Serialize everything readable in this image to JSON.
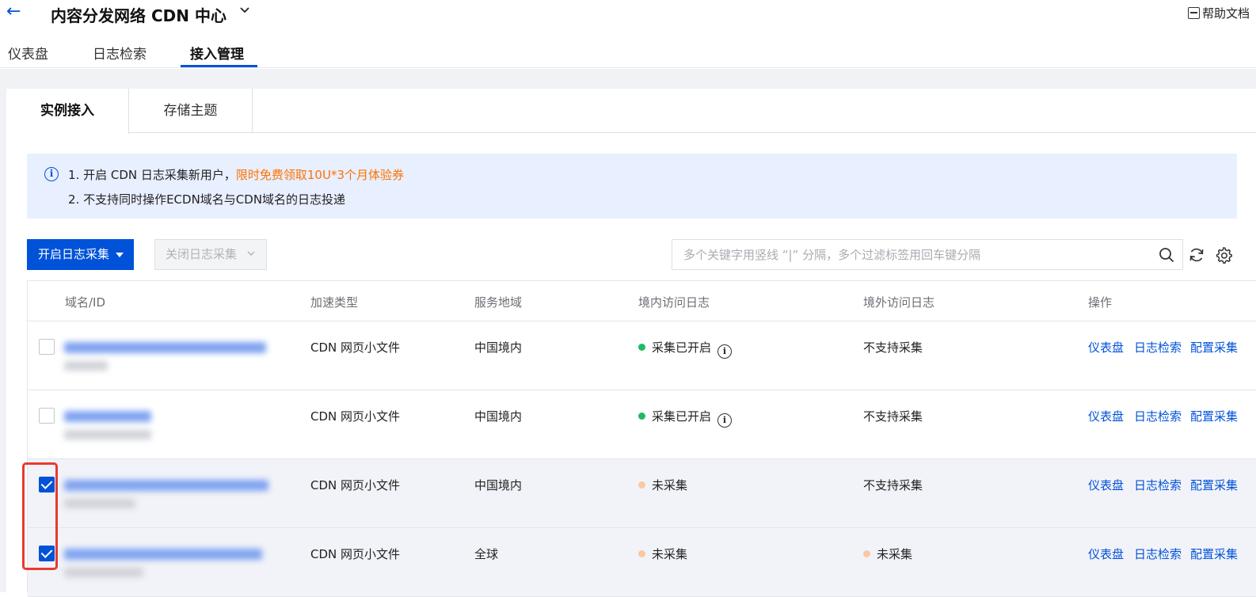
{
  "header": {
    "back_icon": "arrow-left-icon",
    "title": "内容分发网络 CDN 中心",
    "help": "帮助文档"
  },
  "nav_tabs": [
    {
      "label": "仪表盘",
      "active": false
    },
    {
      "label": "日志检索",
      "active": false
    },
    {
      "label": "接入管理",
      "active": true
    }
  ],
  "sub_tabs": [
    {
      "label": "实例接入",
      "active": true
    },
    {
      "label": "存储主题",
      "active": false
    }
  ],
  "notice": {
    "line1_prefix": "1. 开启 CDN 日志采集新用户，",
    "line1_link": "限时免费领取10U*3个月体验券",
    "line2": "2. 不支持同时操作ECDN域名与CDN域名的日志投递"
  },
  "toolbar": {
    "enable_button": "开启日志采集",
    "disable_button": "关闭日志采集",
    "search_placeholder": "多个关键字用竖线 “|” 分隔，多个过滤标签用回车键分隔"
  },
  "table": {
    "columns": [
      "域名/ID",
      "加速类型",
      "服务地域",
      "境内访问日志",
      "境外访问日志",
      "操作"
    ],
    "rows": [
      {
        "checked": false,
        "type": "CDN 网页小文件",
        "region": "中国境内",
        "domestic": "采集已开启",
        "domestic_status": "on",
        "overseas": "不支持采集",
        "overseas_status": "none"
      },
      {
        "checked": false,
        "type": "CDN 网页小文件",
        "region": "中国境内",
        "domestic": "采集已开启",
        "domestic_status": "on",
        "overseas": "不支持采集",
        "overseas_status": "none"
      },
      {
        "checked": true,
        "type": "CDN 网页小文件",
        "region": "中国境内",
        "domestic": "未采集",
        "domestic_status": "off",
        "overseas": "不支持采集",
        "overseas_status": "none"
      },
      {
        "checked": true,
        "type": "CDN 网页小文件",
        "region": "全球",
        "domestic": "未采集",
        "domestic_status": "off",
        "overseas": "未采集",
        "overseas_status": "off"
      }
    ],
    "actions": [
      "仪表盘",
      "日志检索",
      "配置采集"
    ]
  },
  "colors": {
    "primary": "#0052d9",
    "notice_link": "#ff7200",
    "status_on": "#1dbb62",
    "status_off": "#fbc8a0",
    "highlight": "#e63b2e"
  }
}
